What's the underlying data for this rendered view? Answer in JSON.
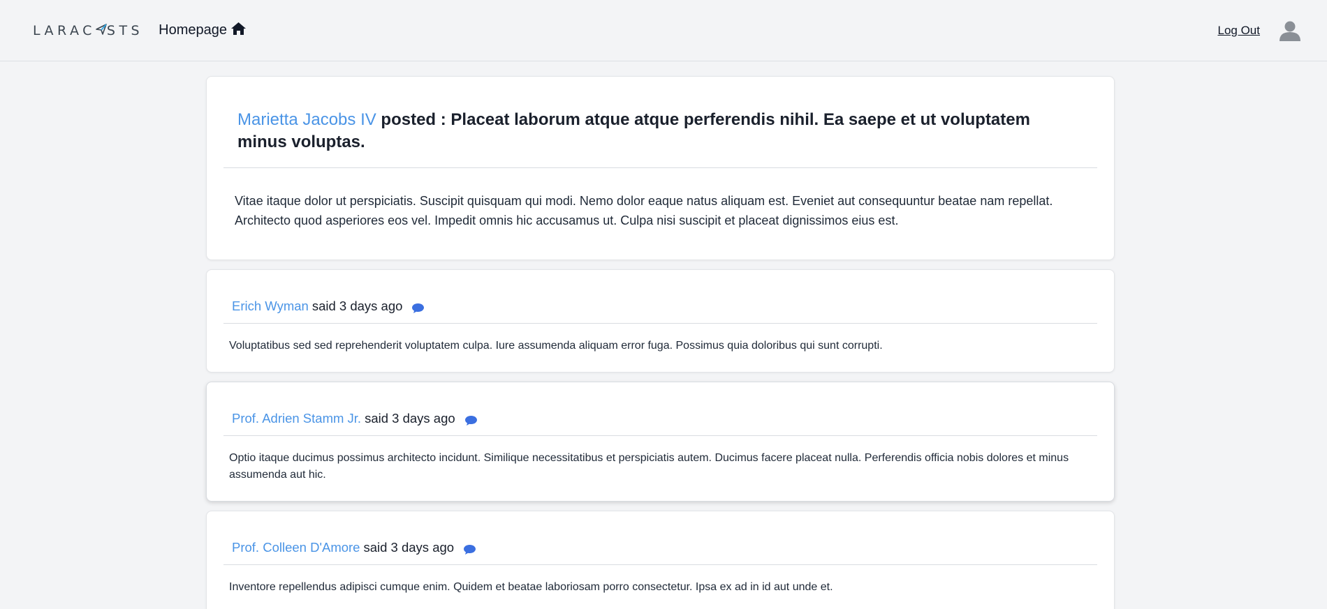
{
  "nav": {
    "logo_text_a": "LARAC",
    "logo_text_b": "STS",
    "home_label": "Homepage",
    "logout_label": "Log Out",
    "icons": {
      "home": "home-icon",
      "avatar": "user-avatar-icon",
      "logo_mark": "paper-plane-icon"
    },
    "accent": "#30a7e4"
  },
  "post": {
    "author": "Marietta Jacobs IV",
    "title": " posted : Placeat laborum atque atque perferendis nihil. Ea saepe et ut voluptatem minus voluptas.",
    "body": "Vitae itaque dolor ut perspiciatis. Suscipit quisquam qui modi. Nemo dolor eaque natus aliquam est. Eveniet aut consequuntur beatae nam repellat. Architecto quod asperiores eos vel. Impedit omnis hic accusamus ut. Culpa nisi suscipit et placeat dignissimos eius est."
  },
  "replies": [
    {
      "author": "Erich Wyman",
      "said": "said 3 days ago",
      "body": "Voluptatibus sed sed reprehenderit voluptatem culpa. Iure assumenda aliquam error fuga. Possimus quia doloribus qui sunt corrupti."
    },
    {
      "author": "Prof. Adrien Stamm Jr.",
      "said": "said 3 days ago",
      "body": "Optio itaque ducimus possimus architecto incidunt. Similique necessitatibus et perspiciatis autem. Ducimus facere placeat nulla. Perferendis officia nobis dolores et minus assumenda aut hic."
    },
    {
      "author": "Prof. Colleen D'Amore",
      "said": "said 3 days ago",
      "body": "Inventore repellendus adipisci cumque enim. Quidem et beatae laboriosam porro consectetur. Ipsa ex ad in id aut unde et."
    }
  ],
  "colors": {
    "link": "#4a94e6",
    "comment_icon": "#3b6fe0",
    "background": "#f3f4f6"
  }
}
